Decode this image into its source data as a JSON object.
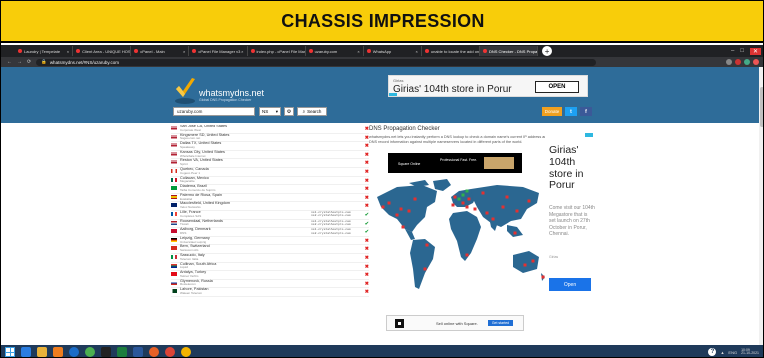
{
  "banner": {
    "title": "CHASSIS IMPRESSION"
  },
  "browser": {
    "tabs": [
      {
        "label": "Laundry | Tempelate",
        "active": false
      },
      {
        "label": "Client Area - UNIQUE HOSTING",
        "active": false
      },
      {
        "label": "cPanel - Main",
        "active": false
      },
      {
        "label": "cPanel File Manager v3",
        "active": false
      },
      {
        "label": "index.php - cPanel File Manager",
        "active": false
      },
      {
        "label": "uzaruby.com",
        "active": false
      },
      {
        "label": "WhatsApp",
        "active": false
      },
      {
        "label": "unable to locate the add on proce",
        "active": false
      },
      {
        "label": "DNS Checker - DNS Propagation",
        "active": true
      }
    ],
    "newtab_symbol": "+",
    "url": "whatsmydns.net/#NS/uzaruby.com",
    "window_controls": [
      "–",
      "□",
      "✕"
    ]
  },
  "site": {
    "brand": "whatsmydns.net",
    "tagline": "Global DNS Propagation Checker",
    "top_ad": {
      "small": "Girias",
      "headline": "Girias' 104th store in Porur",
      "cta": "OPEN"
    },
    "search": {
      "value": "uzaruby.com",
      "record_type": "NS",
      "gear_icon": "⚙",
      "search_label": "Search",
      "donate_label": "Donate",
      "twitter_label": "t",
      "facebook_label": "f"
    }
  },
  "servers": [
    {
      "city": "San Jose CA, United States",
      "provider": "Corporate West",
      "flag": "us",
      "status": "fail",
      "result": []
    },
    {
      "city": "Kingsmere SD, United States",
      "provider": "Sogeo.com.net",
      "flag": "us",
      "status": "fail",
      "result": []
    },
    {
      "city": "Dallas TX, United States",
      "provider": "Speakeasy",
      "flag": "us",
      "status": "fail",
      "result": []
    },
    {
      "city": "Kansas City, United States",
      "provider": "WholeSale Internet",
      "flag": "us",
      "status": "fail",
      "result": []
    },
    {
      "city": "Reston VA, United States",
      "provider": "Sprint",
      "flag": "us",
      "status": "fail",
      "result": []
    },
    {
      "city": "Quebec, Canada",
      "provider": "Cogeco Peer 1",
      "flag": "ca",
      "status": "fail",
      "result": []
    },
    {
      "city": "Culiacan, Mexico",
      "provider": "Megacable",
      "flag": "mx",
      "status": "fail",
      "result": []
    },
    {
      "city": "Diadema, Brazil",
      "provider": "Taiba Comercio de Suprim",
      "flag": "br",
      "status": "fail",
      "result": []
    },
    {
      "city": "Palermo de Riosa, Spain",
      "provider": "Euskaltel",
      "flag": "es",
      "status": "fail",
      "result": []
    },
    {
      "city": "Macclesfield, United Kingdom",
      "provider": "Veloc Networks",
      "flag": "gb",
      "status": "fail",
      "result": []
    },
    {
      "city": "Lille, France",
      "provider": "CompleteL SAS",
      "flag": "fr",
      "status": "ok",
      "result": [
        "ns1.crystalhostpro.com",
        "ns2.crystalhostpro.com"
      ]
    },
    {
      "city": "Roosendaal, Netherlands",
      "provider": "Tiscali",
      "flag": "nl",
      "status": "ok",
      "result": [
        "ns1.crystalhostpro.com",
        "ns2.crystalhostpro.com"
      ]
    },
    {
      "city": "Aalborg, Denmark",
      "provider": "DNS",
      "flag": "dk",
      "status": "ok",
      "result": [
        "ns1.crystalhostpro.com",
        "ns2.crystalhostpro.com"
      ]
    },
    {
      "city": "Leipzig, Germany",
      "provider": "Universitaet Leipzig",
      "flag": "de",
      "status": "fail",
      "result": []
    },
    {
      "city": "Bern, Switzerland",
      "provider": "Swisscom AG",
      "flag": "ch",
      "status": "fail",
      "result": []
    },
    {
      "city": "Sassuolo, Italy",
      "provider": "Telecom Italia",
      "flag": "it",
      "status": "fail",
      "result": []
    },
    {
      "city": "Cullinan, South Africa",
      "provider": "Liquid",
      "flag": "za",
      "status": "fail",
      "result": []
    },
    {
      "city": "Antalya, Turkey",
      "provider": "Teknet Yazlim",
      "flag": "tr",
      "status": "fail",
      "result": []
    },
    {
      "city": "Glymenovk, Russia",
      "provider": "Rostelecom",
      "flag": "ru",
      "status": "fail",
      "result": []
    },
    {
      "city": "Lahore, Pakistan",
      "provider": "Wateen Telecom",
      "flag": "pk",
      "status": "fail",
      "result": []
    }
  ],
  "status_symbols": {
    "fail": "✖",
    "ok": "✔"
  },
  "main": {
    "title": "DNS Propagation Checker",
    "description": "whatsmydns.net lets you instantly perform a DNS lookup to check a domain name's current IP address and DNS record information against multiple nameservers located in different parts of the world.",
    "mid_ad": {
      "label": "Square Online",
      "label2": "Professional Fast. Free."
    },
    "bottom_ad": {
      "text": "Sell online with Square.",
      "cta": "Get started"
    }
  },
  "side_ad": {
    "headline": "Girias' 104th store in Porur",
    "body": "Come visit our 104th Megastore that is set launch on 27th October in Porur, Chennai.",
    "brand": "Girias",
    "cta": "Open"
  },
  "taskbar": {
    "tray_lang": "ENG",
    "time": "10:09",
    "date": "21-10-2021",
    "help_symbol": "?"
  },
  "colors": {
    "banner_bg": "#f8cd0a",
    "site_header": "#2e6c99",
    "fail": "#e02020",
    "ok": "#20a040",
    "map_land": "#2b6791",
    "map_marker_fail": "#e53030",
    "map_marker_ok": "#2fb24c"
  }
}
